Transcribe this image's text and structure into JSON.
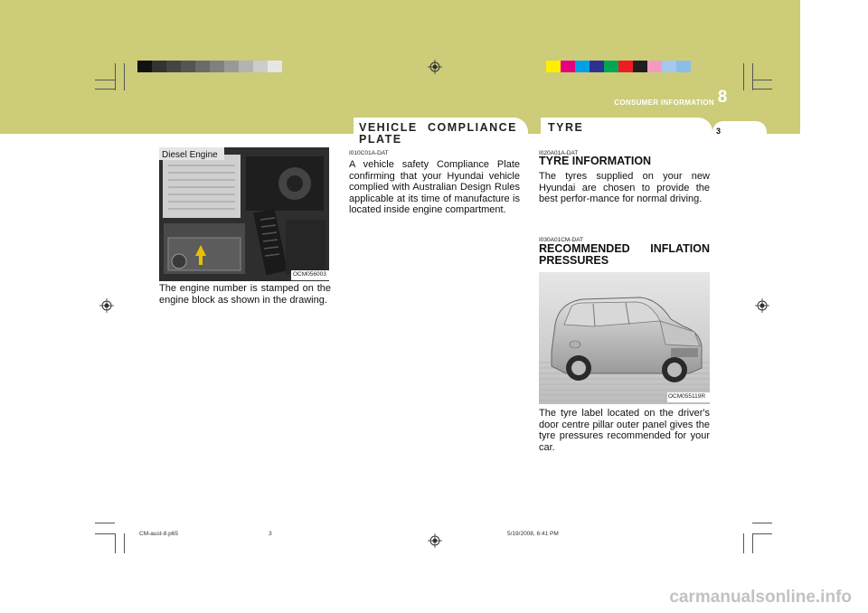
{
  "header": {
    "section_label": "CONSUMER INFORMATION",
    "chapter_number": "8",
    "page_number": "3",
    "colors": {
      "band": "#cccc79",
      "grey_strip": [
        "#111111",
        "#333333",
        "#444444",
        "#555555",
        "#6a6a6a",
        "#808080",
        "#999999",
        "#b3b3b3",
        "#cccccc",
        "#e6e6e6"
      ],
      "color_strip": [
        "#ffee00",
        "#e6007e",
        "#00a0e6",
        "#2e3192",
        "#00a651",
        "#ed1c24",
        "#231f20",
        "#f49ac1",
        "#a5c8ee",
        "#89bfe6"
      ]
    }
  },
  "col1": {
    "photo_label": "Diesel  Engine",
    "photo_code": "OCM056003",
    "body": "The engine number is stamped on the engine block as shown in the drawing.",
    "photo_icon": "engine-photo-icon"
  },
  "col2": {
    "tab_title": "VEHICLE  COMPLIANCE PLATE",
    "code": "I010C01A-DAT",
    "body": "A vehicle safety Compliance Plate confirming that your Hyundai vehicle complied with Australian Design Rules applicable at its time of manufacture is located inside engine compartment."
  },
  "col3": {
    "tab_title": "TYRE",
    "tyre_info": {
      "code": "I020A01A-DAT",
      "heading": "TYRE INFORMATION",
      "body": "The tyres supplied on your new Hyundai are chosen to provide the best perfor-mance for normal driving."
    },
    "inflation": {
      "code": "I030A01CM-DAT",
      "heading": "RECOMMENDED INFLATION PRESSURES",
      "photo_code": "OCM055119R",
      "body": "The tyre label located on the driver's door centre pillar outer panel gives the tyre pressures recommended for your car.",
      "photo_icon": "suv-photo-icon"
    }
  },
  "footer": {
    "file": "CM-aust-8.p65",
    "page": "3",
    "datetime": "5/19/2008, 6:41 PM"
  },
  "watermark": "carmanualsonline.info"
}
